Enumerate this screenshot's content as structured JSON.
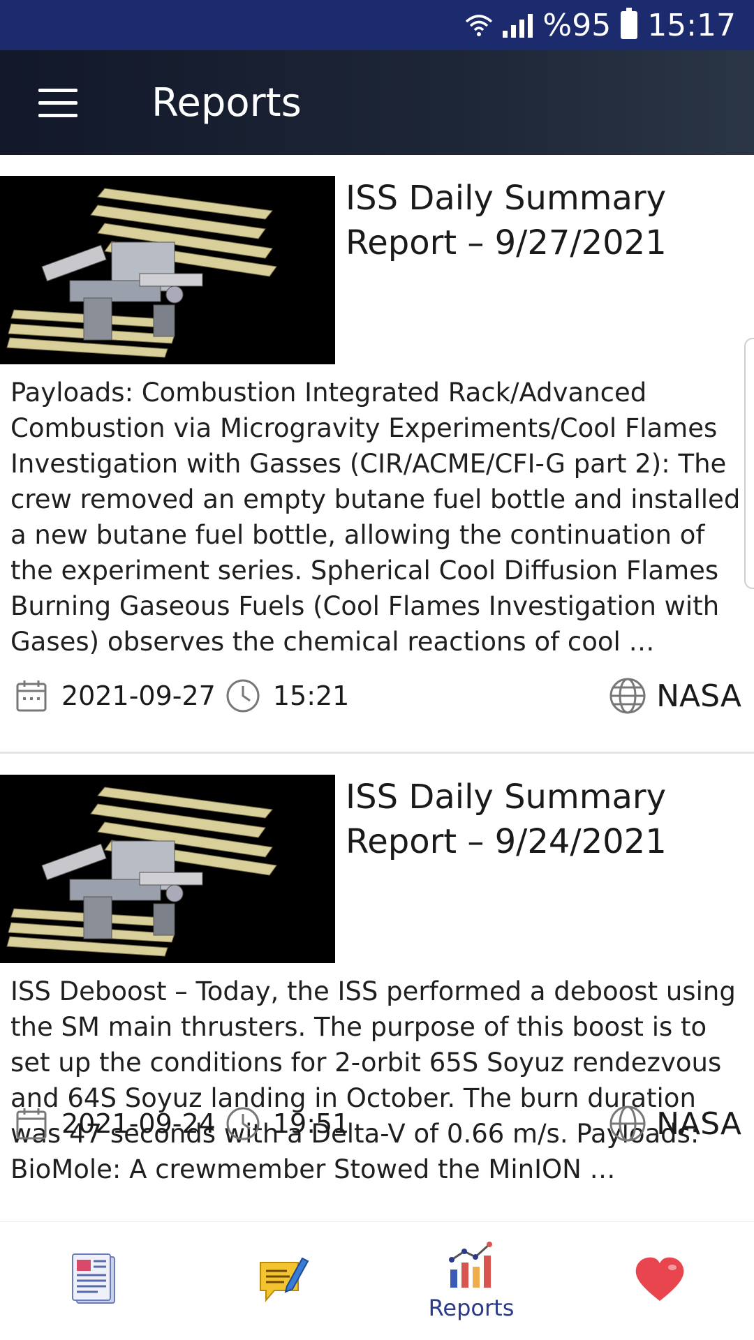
{
  "status_bar": {
    "battery_text": "%95",
    "time": "15:17",
    "icons": [
      "wifi-icon",
      "signal-icon",
      "battery-icon"
    ]
  },
  "app_bar": {
    "title": "Reports",
    "menu_icon": "hamburger-menu-icon"
  },
  "reports": [
    {
      "title": "ISS Daily Summary Report – 9/27/2021",
      "summary": "Payloads: Combustion Integrated Rack/Advanced Combustion via Microgravity Experiments/Cool Flames Investigation with Gasses (CIR/ACME/CFI-G part 2): The crew removed an empty butane fuel bottle and installed a new butane fuel bottle, allowing the continuation of the experiment series. Spherical Cool Diffusion Flames Burning Gaseous Fuels (Cool Flames Investigation with Gases) observes the chemical reactions of cool …",
      "date": "2021-09-27",
      "time": "15:21",
      "source": "NASA"
    },
    {
      "title": "ISS Daily Summary Report – 9/24/2021",
      "summary": "ISS Deboost – Today, the ISS performed a deboost using the SM main thrusters. The purpose of this boost is to set up the conditions for 2-orbit 65S Soyuz rendezvous and 64S Soyuz landing in October. The burn duration was 47 seconds with a Delta-V of 0.66 m/s. Payloads: BioMole:  A crewmember Stowed the MinION …",
      "date": "2021-09-24",
      "time": "19:51",
      "source": "NASA"
    }
  ],
  "bottom_nav": {
    "items": [
      {
        "icon": "news-document-icon",
        "label": ""
      },
      {
        "icon": "notes-pencil-icon",
        "label": ""
      },
      {
        "icon": "reports-chart-icon",
        "label": "Reports",
        "active": true
      },
      {
        "icon": "heart-favorites-icon",
        "label": ""
      }
    ]
  },
  "colors": {
    "status_bar": "#1c2a6e",
    "app_bar": "#1a2233",
    "active_nav": "#2b3a8a"
  }
}
